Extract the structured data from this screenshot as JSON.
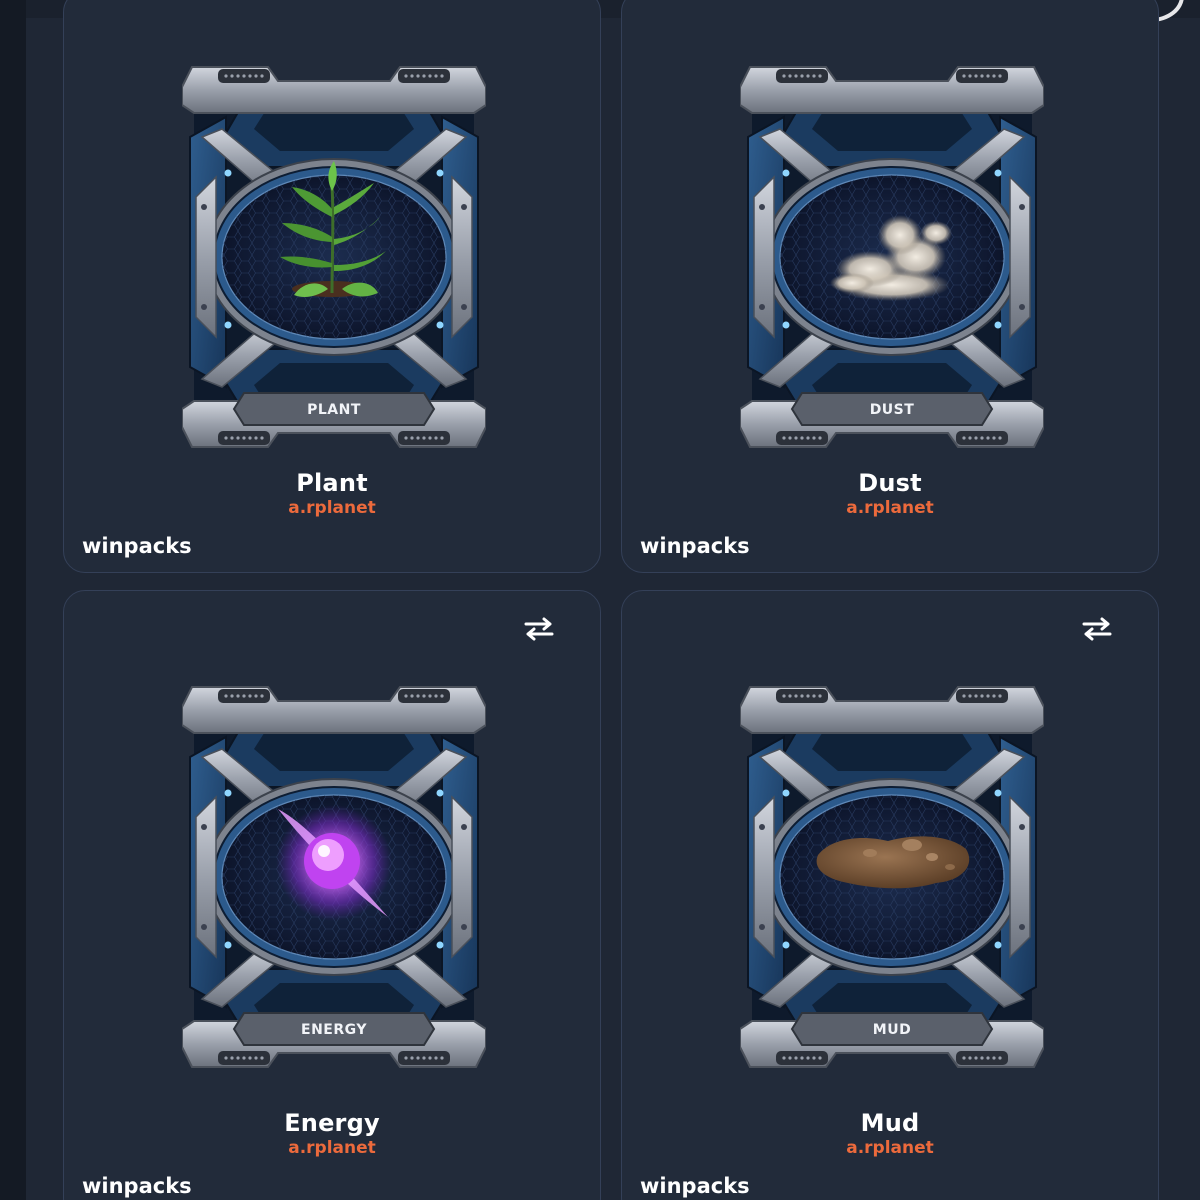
{
  "cards": [
    {
      "title": "Plant",
      "collection": "a.rplanet",
      "owner": "winpacks",
      "plate": "PLANT",
      "art": "plant-image",
      "swap_icon": "swap-icon",
      "has_swap": false
    },
    {
      "title": "Dust",
      "collection": "a.rplanet",
      "owner": "winpacks",
      "plate": "DUST",
      "art": "dust-image",
      "swap_icon": "swap-icon",
      "has_swap": false
    },
    {
      "title": "Energy",
      "collection": "a.rplanet",
      "owner": "winpacks",
      "plate": "ENERGY",
      "art": "energy-image",
      "swap_icon": "swap-icon",
      "has_swap": true
    },
    {
      "title": "Mud",
      "collection": "a.rplanet",
      "owner": "winpacks",
      "plate": "MUD",
      "art": "mud-image",
      "swap_icon": "swap-icon",
      "has_swap": true
    }
  ],
  "colors": {
    "background": "#1f2735",
    "card": "#222b3a",
    "card_border": "#344058",
    "title": "#ffffff",
    "collection_accent": "#ec6a3c"
  }
}
